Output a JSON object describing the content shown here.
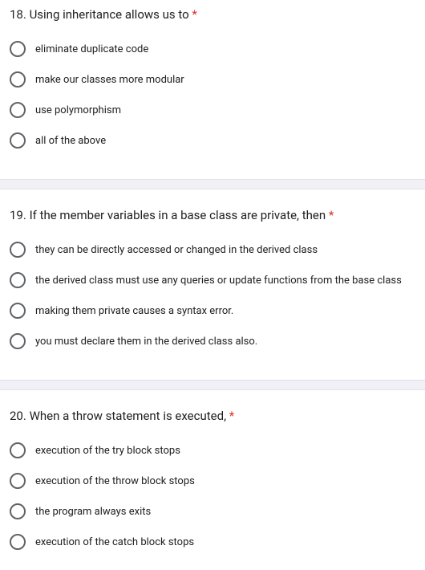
{
  "questions": [
    {
      "number": "18.",
      "text": "Using inheritance allows us to",
      "required": "*",
      "options": [
        "eliminate duplicate code",
        "make our classes more modular",
        "use polymorphism",
        "all of the above"
      ]
    },
    {
      "number": "19.",
      "text": "If the member variables in a base class are private, then",
      "required": "*",
      "options": [
        "they can be directly accessed or changed in the derived class",
        "the derived class must use any queries or update functions from the base class",
        "making them private causes a syntax error.",
        "you must declare them in the derived class also."
      ]
    },
    {
      "number": "20.",
      "text": "When a throw statement is executed,",
      "required": "*",
      "options": [
        "execution of the try block stops",
        "execution of the throw block stops",
        "the program always exits",
        "execution of the catch block stops"
      ]
    }
  ]
}
